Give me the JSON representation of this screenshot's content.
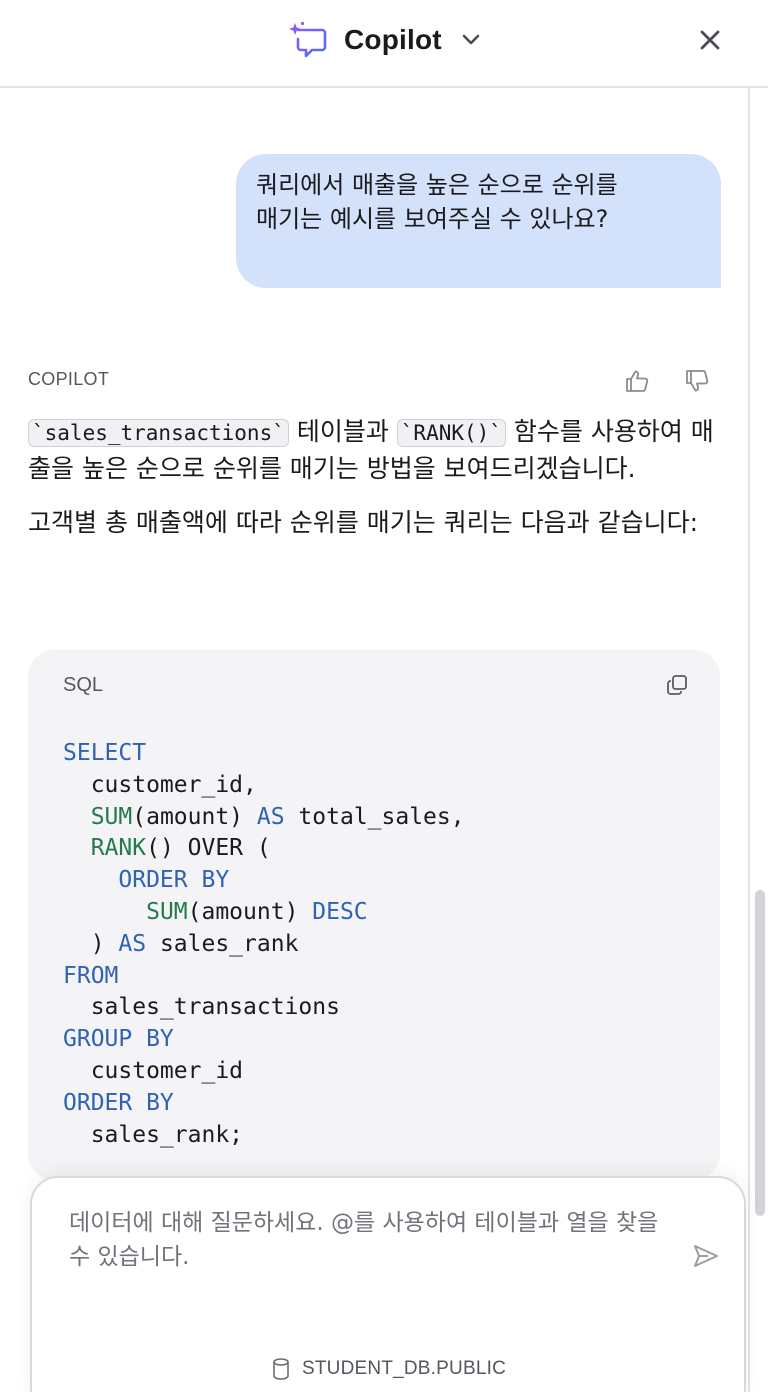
{
  "header": {
    "title": "Copilot",
    "logo_icon": "copilot-sparkle-chat-icon",
    "chevron_icon": "chevron-down-icon",
    "close_icon": "close-icon"
  },
  "conversation": {
    "user_message": "쿼리에서 매출을 높은 순으로 순위를\n매기는 예시를 보여주실 수 있나요?",
    "assistant": {
      "label": "COPILOT",
      "thumbs_up_icon": "thumbs-up-icon",
      "thumbs_down_icon": "thumbs-down-icon",
      "p1_chip1": "`sales_transactions`",
      "p1_mid": " 테이블과 ",
      "p1_chip2": "`RANK()`",
      "p1_end": " 함수를 사용하여 매출을 높은 순으로 순위를 매기는 방법을 보여드리겠습니다.",
      "p2": "고객별 총 매출액에 따라 순위를 매기는 쿼리는 다음과 같습니다:",
      "code": {
        "language": "SQL",
        "copy_icon": "copy-icon",
        "lines": [
          [
            {
              "t": "SELECT",
              "c": "kw"
            }
          ],
          [
            {
              "t": "  customer_id,",
              "c": ""
            }
          ],
          [
            {
              "t": "  ",
              "c": ""
            },
            {
              "t": "SUM",
              "c": "fn"
            },
            {
              "t": "(amount) ",
              "c": ""
            },
            {
              "t": "AS",
              "c": "kw"
            },
            {
              "t": " total_sales,",
              "c": ""
            }
          ],
          [
            {
              "t": "  ",
              "c": ""
            },
            {
              "t": "RANK",
              "c": "fn"
            },
            {
              "t": "() OVER (",
              "c": ""
            }
          ],
          [
            {
              "t": "    ",
              "c": ""
            },
            {
              "t": "ORDER BY",
              "c": "kw"
            }
          ],
          [
            {
              "t": "      ",
              "c": ""
            },
            {
              "t": "SUM",
              "c": "fn"
            },
            {
              "t": "(amount) ",
              "c": ""
            },
            {
              "t": "DESC",
              "c": "kw"
            }
          ],
          [
            {
              "t": "  ) ",
              "c": ""
            },
            {
              "t": "AS",
              "c": "kw"
            },
            {
              "t": " sales_rank",
              "c": ""
            }
          ],
          [
            {
              "t": "FROM",
              "c": "kw"
            }
          ],
          [
            {
              "t": "  sales_transactions",
              "c": ""
            }
          ],
          [
            {
              "t": "GROUP BY",
              "c": "kw"
            }
          ],
          [
            {
              "t": "  customer_id",
              "c": ""
            }
          ],
          [
            {
              "t": "ORDER BY",
              "c": "kw"
            }
          ],
          [
            {
              "t": "  sales_rank;",
              "c": ""
            }
          ]
        ]
      }
    }
  },
  "input": {
    "placeholder": "데이터에 대해 질문하세요. @를 사용하여 테이블과 열을 찾을 수 있습니다.",
    "send_icon": "send-icon",
    "database_icon": "database-icon",
    "context": "STUDENT_DB.PUBLIC"
  },
  "colors": {
    "user_bubble": "#d3e1fb",
    "keyword": "#2f62b5",
    "function": "#257a4d",
    "code_bg": "#f4f4f6",
    "logo_gradient_start": "#8b5cf6",
    "logo_gradient_end": "#4f6ef7"
  }
}
